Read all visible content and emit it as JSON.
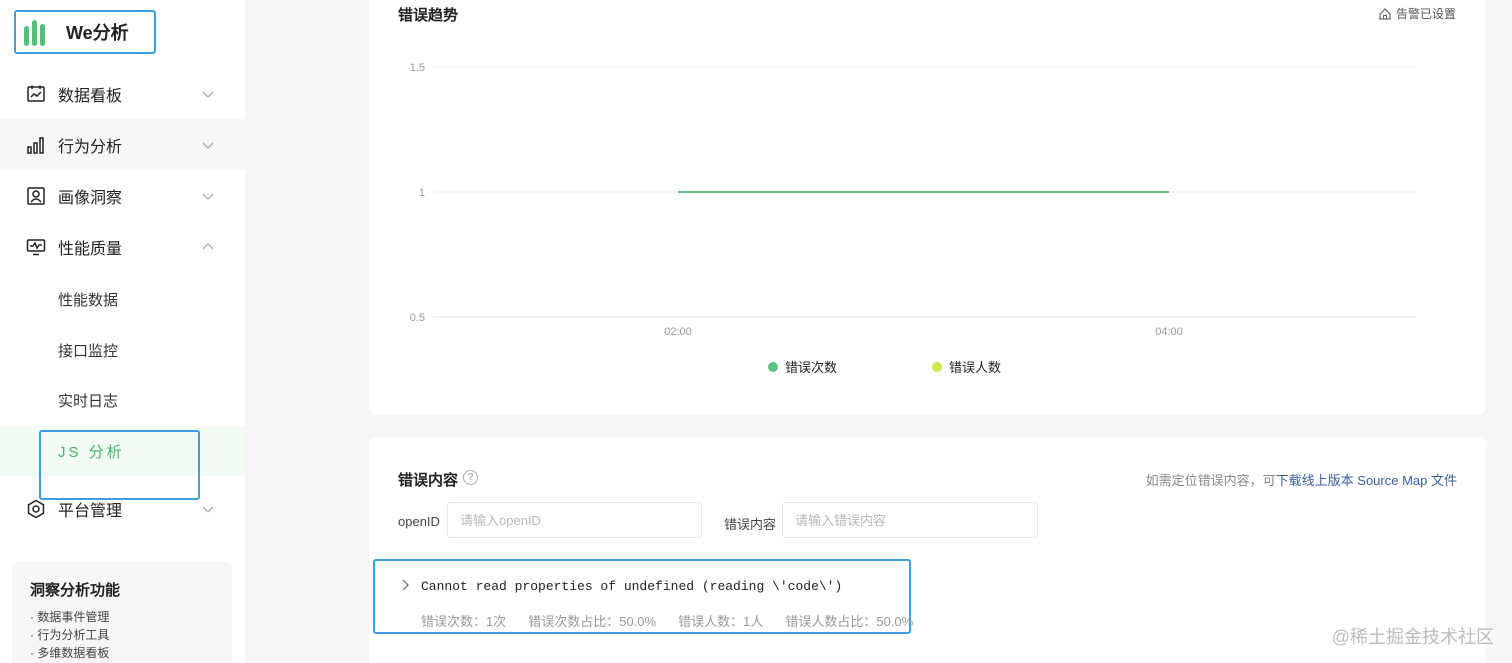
{
  "app": {
    "name": "We分析"
  },
  "sidebar": {
    "menu": [
      {
        "label": "数据看板",
        "icon": "chart-board-icon",
        "expanded": false
      },
      {
        "label": "行为分析",
        "icon": "bar-chart-icon",
        "expanded": false
      },
      {
        "label": "画像洞察",
        "icon": "portrait-icon",
        "expanded": false
      },
      {
        "label": "性能质量",
        "icon": "monitor-icon",
        "expanded": true
      },
      {
        "label": "平台管理",
        "icon": "settings-hex-icon",
        "expanded": false
      }
    ],
    "submenu": [
      {
        "label": "性能数据"
      },
      {
        "label": "接口监控"
      },
      {
        "label": "实时日志"
      },
      {
        "label": "JS 分析",
        "active": true
      }
    ],
    "feature_card": {
      "title": "洞察分析功能",
      "items": [
        "· 数据事件管理",
        "· 行为分析工具",
        "· 多维数据看板"
      ]
    }
  },
  "trend": {
    "title": "错误趋势",
    "alert_label": "告警已设置"
  },
  "chart_data": {
    "type": "line",
    "title": "",
    "x": [
      "02:00",
      "04:00"
    ],
    "ylim": [
      0.5,
      1.5
    ],
    "yticks": [
      "1.5",
      "1",
      "0.5"
    ],
    "series": [
      {
        "name": "错误次数",
        "values": [
          1,
          1
        ],
        "color": "#5cc584"
      },
      {
        "name": "错误人数",
        "values": [
          1,
          1
        ],
        "color": "#cde84a"
      }
    ],
    "grid": true,
    "legend": "bottom"
  },
  "content": {
    "title": "错误内容",
    "help_icon": "?",
    "hint_prefix": "如需定位错误内容，可",
    "hint_link": "下载线上版本 Source Map 文件",
    "filters": {
      "openid_label": "openID",
      "openid_placeholder": "请输入openID",
      "content_label": "错误内容",
      "content_placeholder": "请输入错误内容"
    },
    "error": {
      "message": "Cannot read properties of undefined (reading \\'code\\')",
      "stats": {
        "count": "错误次数：1次",
        "count_ratio": "错误次数占比：50.0%",
        "users": "错误人数：1人",
        "users_ratio": "错误人数占比：50.0%"
      }
    }
  },
  "watermark": "@稀土掘金技术社区",
  "colors": {
    "accent": "#3fbb6a",
    "highlight_border": "#3b9fe0",
    "link": "#3a5f9f"
  }
}
